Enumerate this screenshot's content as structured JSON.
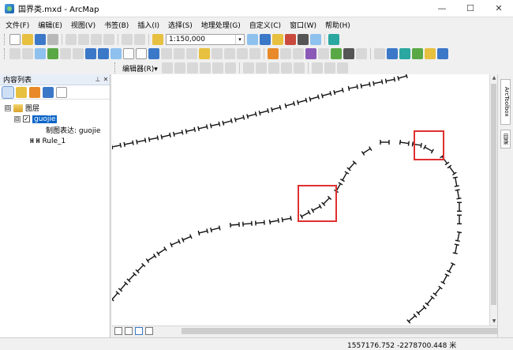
{
  "window": {
    "title": "国界类.mxd - ArcMap",
    "minimize": "—",
    "maximize": "☐",
    "close": "✕"
  },
  "menu": [
    "文件(F)",
    "编辑(E)",
    "视图(V)",
    "书签(B)",
    "插入(I)",
    "选择(S)",
    "地理处理(G)",
    "自定义(C)",
    "窗口(W)",
    "帮助(H)"
  ],
  "toolbar": {
    "scale_value": "1:150,000",
    "scale_dropdown": "▾",
    "editor_label": "编辑器(R)▾"
  },
  "toc": {
    "title": "内容列表",
    "pin": "📌",
    "close": "✕",
    "root_expander": "⊟",
    "root_label": "图层",
    "layer_expander": "⊟",
    "layer_check": "✓",
    "layer_name": "guojie",
    "representation_label": "制图表达: guojie",
    "rule_symbol": "H H",
    "rule_label": "Rule_1"
  },
  "scrollbar": {
    "up": "▲",
    "down": "▼"
  },
  "right_dock": {
    "tab1": "ArcToolbox",
    "tab2": "目录"
  },
  "status": {
    "coordinates": "1557176.752  -2278700.448 米"
  },
  "colors": {
    "selection": "#0a64c8",
    "highlight_box": "#e03030",
    "line_symbol": "#111111"
  }
}
